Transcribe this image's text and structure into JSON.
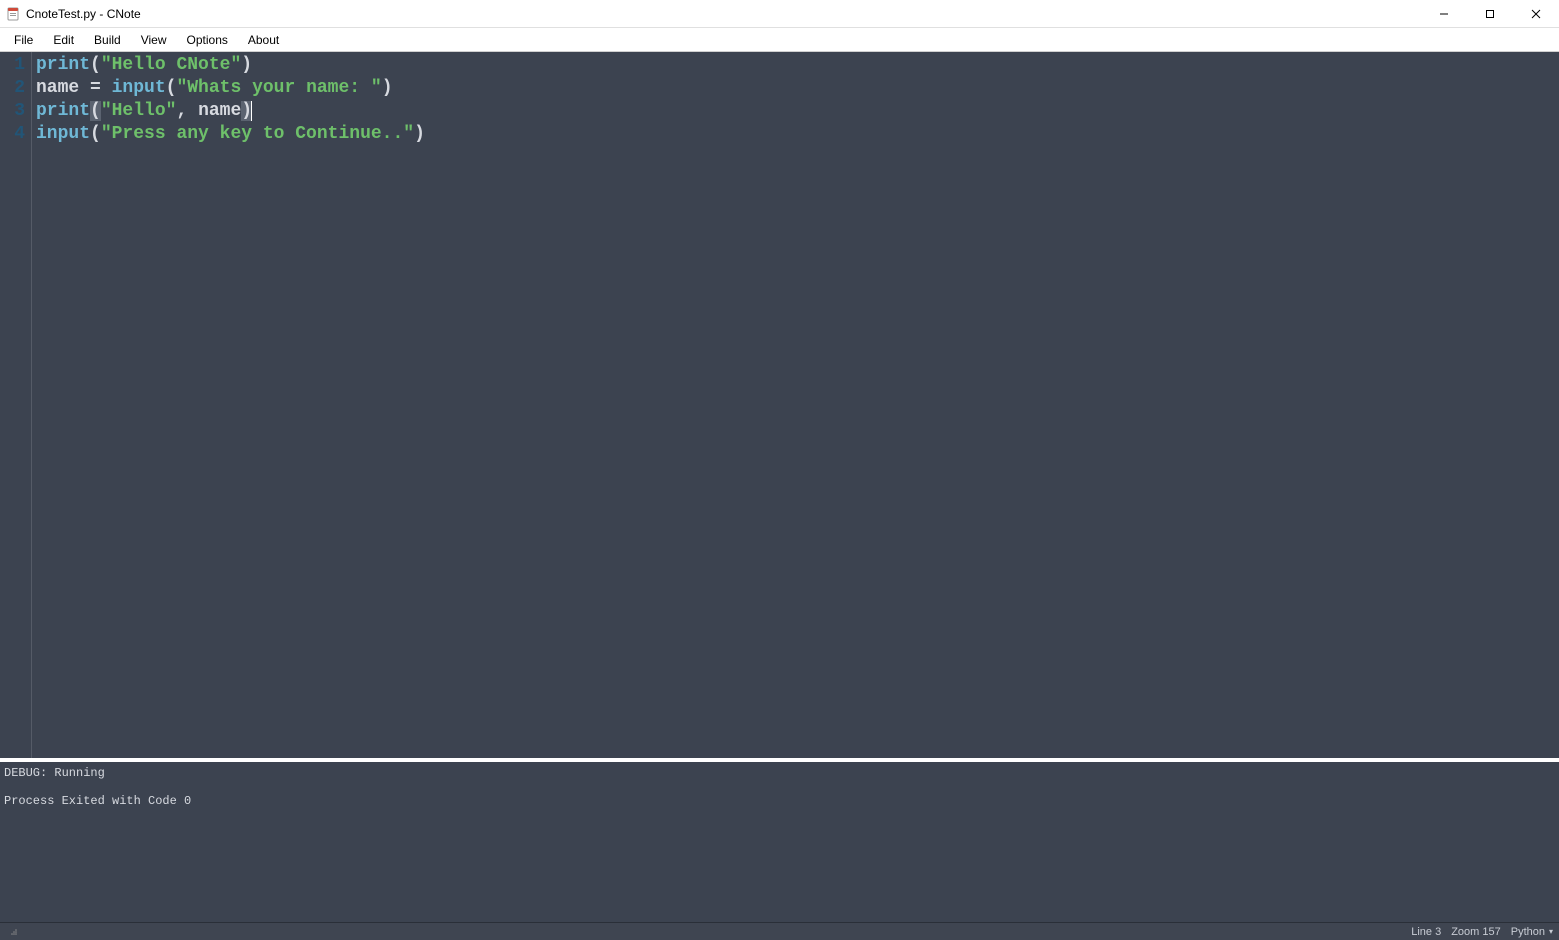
{
  "window": {
    "title": "CnoteTest.py - CNote"
  },
  "menu": {
    "items": [
      "File",
      "Edit",
      "Build",
      "View",
      "Options",
      "About"
    ]
  },
  "editor": {
    "cursor_line": 3,
    "lines": [
      {
        "num": "1",
        "tokens": [
          {
            "t": "print",
            "c": "tok-fn"
          },
          {
            "t": "(",
            "c": "tok-pn"
          },
          {
            "t": "\"Hello CNote\"",
            "c": "tok-str"
          },
          {
            "t": ")",
            "c": "tok-pn"
          }
        ]
      },
      {
        "num": "2",
        "tokens": [
          {
            "t": "name",
            "c": "tok-id"
          },
          {
            "t": " = ",
            "c": "tok-op"
          },
          {
            "t": "input",
            "c": "tok-fn"
          },
          {
            "t": "(",
            "c": "tok-pn"
          },
          {
            "t": "\"Whats your name: \"",
            "c": "tok-str"
          },
          {
            "t": ")",
            "c": "tok-pn"
          }
        ]
      },
      {
        "num": "3",
        "tokens": [
          {
            "t": "print",
            "c": "tok-fn"
          },
          {
            "t": "(",
            "c": "tok-pn-hl"
          },
          {
            "t": "\"Hello\"",
            "c": "tok-str"
          },
          {
            "t": ", ",
            "c": "tok-pn"
          },
          {
            "t": "name",
            "c": "tok-id"
          },
          {
            "t": ")",
            "c": "tok-pn-hl"
          }
        ],
        "caret_after": true
      },
      {
        "num": "4",
        "tokens": [
          {
            "t": "input",
            "c": "tok-fn"
          },
          {
            "t": "(",
            "c": "tok-pn"
          },
          {
            "t": "\"Press any key to Continue..\"",
            "c": "tok-str"
          },
          {
            "t": ")",
            "c": "tok-pn"
          }
        ]
      }
    ]
  },
  "output": {
    "lines": [
      "DEBUG: Running",
      "",
      "Process Exited with Code 0"
    ]
  },
  "status": {
    "line_label": "Line 3",
    "zoom_label": "Zoom 157",
    "language": "Python"
  }
}
